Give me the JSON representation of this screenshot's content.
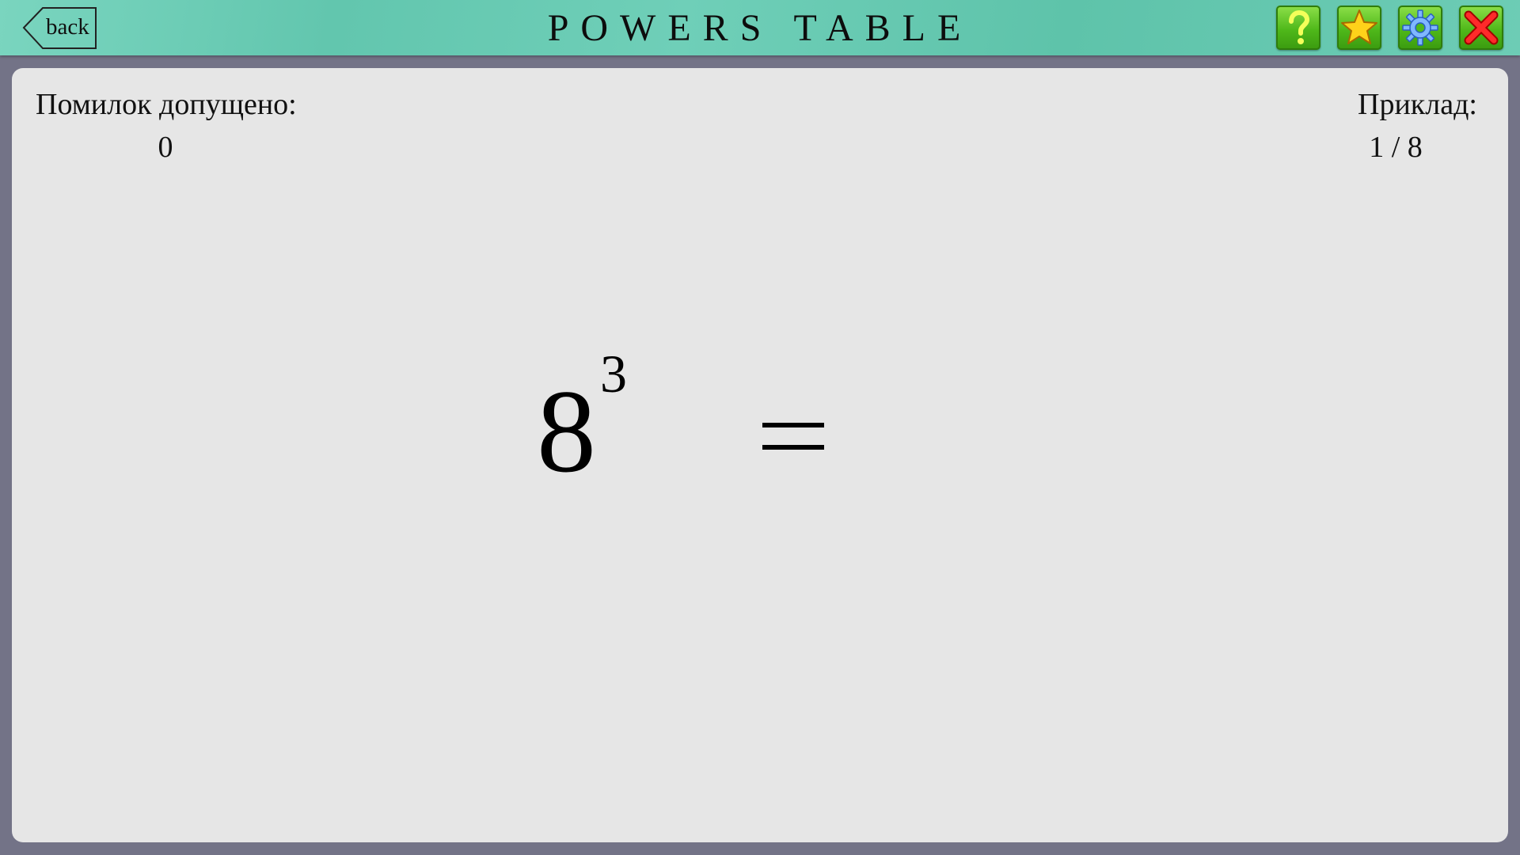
{
  "header": {
    "title": "POWERS TABLE",
    "back_label": "back",
    "buttons": {
      "help_icon": "question-mark",
      "favorite_icon": "star",
      "settings_icon": "gear",
      "close_icon": "x-cross"
    }
  },
  "stats": {
    "mistakes_label": "Помилок допущено:",
    "mistakes_value": "0",
    "example_label": "Приклад:",
    "example_value": "1 / 8"
  },
  "problem": {
    "base": "8",
    "exponent": "3",
    "operator": "=",
    "answer": ""
  },
  "colors": {
    "header": "#6fcfb8",
    "panel": "#e6e6e6",
    "frame": "#737387",
    "button_green": "#4fb81a"
  }
}
